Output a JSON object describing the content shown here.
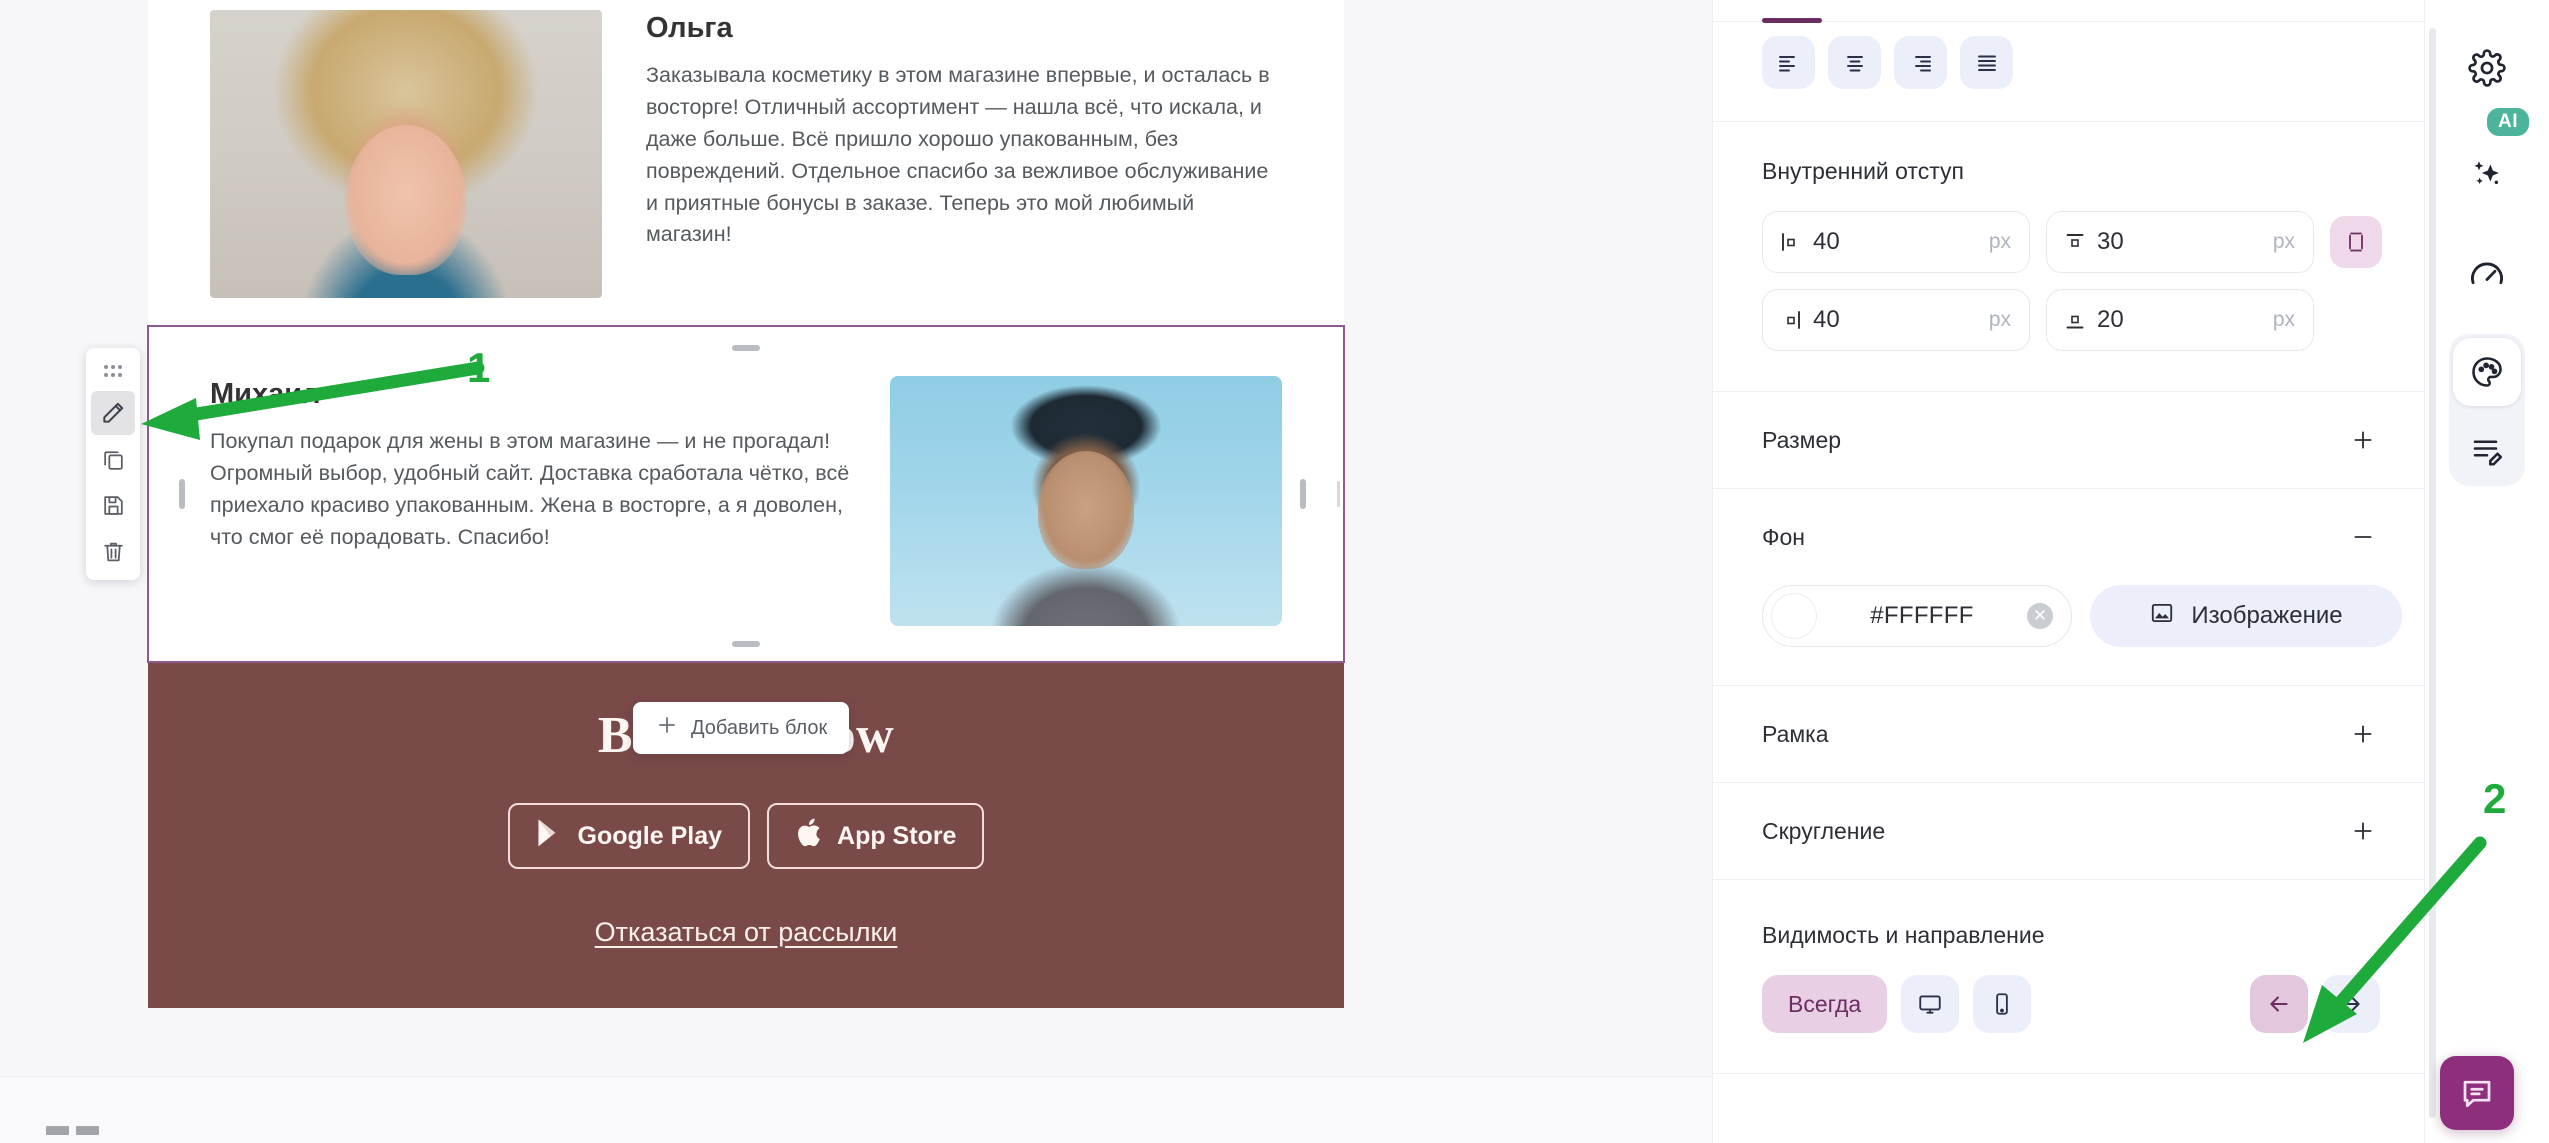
{
  "canvas": {
    "testimonials": [
      {
        "name": "Ольга",
        "text": "Заказывала косметику в этом магазине впервые, и осталась в восторге! Отличный ассортимент — нашла всё, что искала, и даже больше. Всё пришло хорошо упакованным, без повреждений. Отдельное спасибо за вежливое обслуживание и приятные бонусы в заказе. Теперь это мой любимый магазин!",
        "photo_alt": "woman-portrait"
      },
      {
        "name": "Михаил",
        "text": "Покупал подарок для жены в этом магазине — и не прогадал! Огромный выбор, удобный сайт. Доставка сработала чётко, всё приехало красиво упакованным. Жена в восторге, а я доволен, что смог её порадовать. Спасибо!",
        "photo_alt": "man-portrait"
      }
    ],
    "add_block_label": "Добавить блок",
    "block_toolbar": [
      {
        "icon": "drag-handle-icon",
        "name": "drag-handle"
      },
      {
        "icon": "pencil-icon",
        "name": "edit"
      },
      {
        "icon": "copy-icon",
        "name": "duplicate"
      },
      {
        "icon": "save-icon",
        "name": "save"
      },
      {
        "icon": "trash-icon",
        "name": "delete"
      }
    ],
    "footer": {
      "logo": "Belleza Glow",
      "google_play": "Google Play",
      "app_store": "App Store",
      "unsubscribe": "Отказаться от рассылки",
      "bg_color": "#7A4A49"
    }
  },
  "panel": {
    "align": {
      "options": [
        "align-left",
        "align-center",
        "align-right",
        "align-justify"
      ]
    },
    "padding": {
      "title": "Внутренний отступ",
      "left": {
        "value": "40",
        "unit": "px",
        "icon": "padding-left-icon"
      },
      "top": {
        "value": "30",
        "unit": "px",
        "icon": "padding-top-icon"
      },
      "right": {
        "value": "40",
        "unit": "px",
        "icon": "padding-right-icon"
      },
      "bottom": {
        "value": "20",
        "unit": "px",
        "icon": "padding-bottom-icon"
      },
      "link_label": "link-padding"
    },
    "size": {
      "title": "Размер",
      "toggle": "+"
    },
    "background": {
      "title": "Фон",
      "toggle": "−",
      "color": "#FFFFFF",
      "image_button": "Изображение"
    },
    "border": {
      "title": "Рамка",
      "toggle": "+"
    },
    "radius": {
      "title": "Скругление",
      "toggle": "+"
    },
    "visibility": {
      "title": "Видимость и направление",
      "always": "Всегда",
      "desktop_icon": "desktop-icon",
      "mobile_icon": "mobile-icon",
      "prev_icon": "arrow-left-icon",
      "next_icon": "arrow-right-icon"
    }
  },
  "rail": {
    "items": [
      {
        "name": "settings-icon"
      },
      {
        "name": "ai-sparkle-icon",
        "badge": "AI"
      },
      {
        "name": "speedometer-icon"
      },
      {
        "name": "palette-icon"
      },
      {
        "name": "content-edit-icon"
      }
    ],
    "chat_icon": "chat-icon"
  },
  "annotations": {
    "one": "1",
    "two": "2",
    "color": "#1FAA3C"
  }
}
